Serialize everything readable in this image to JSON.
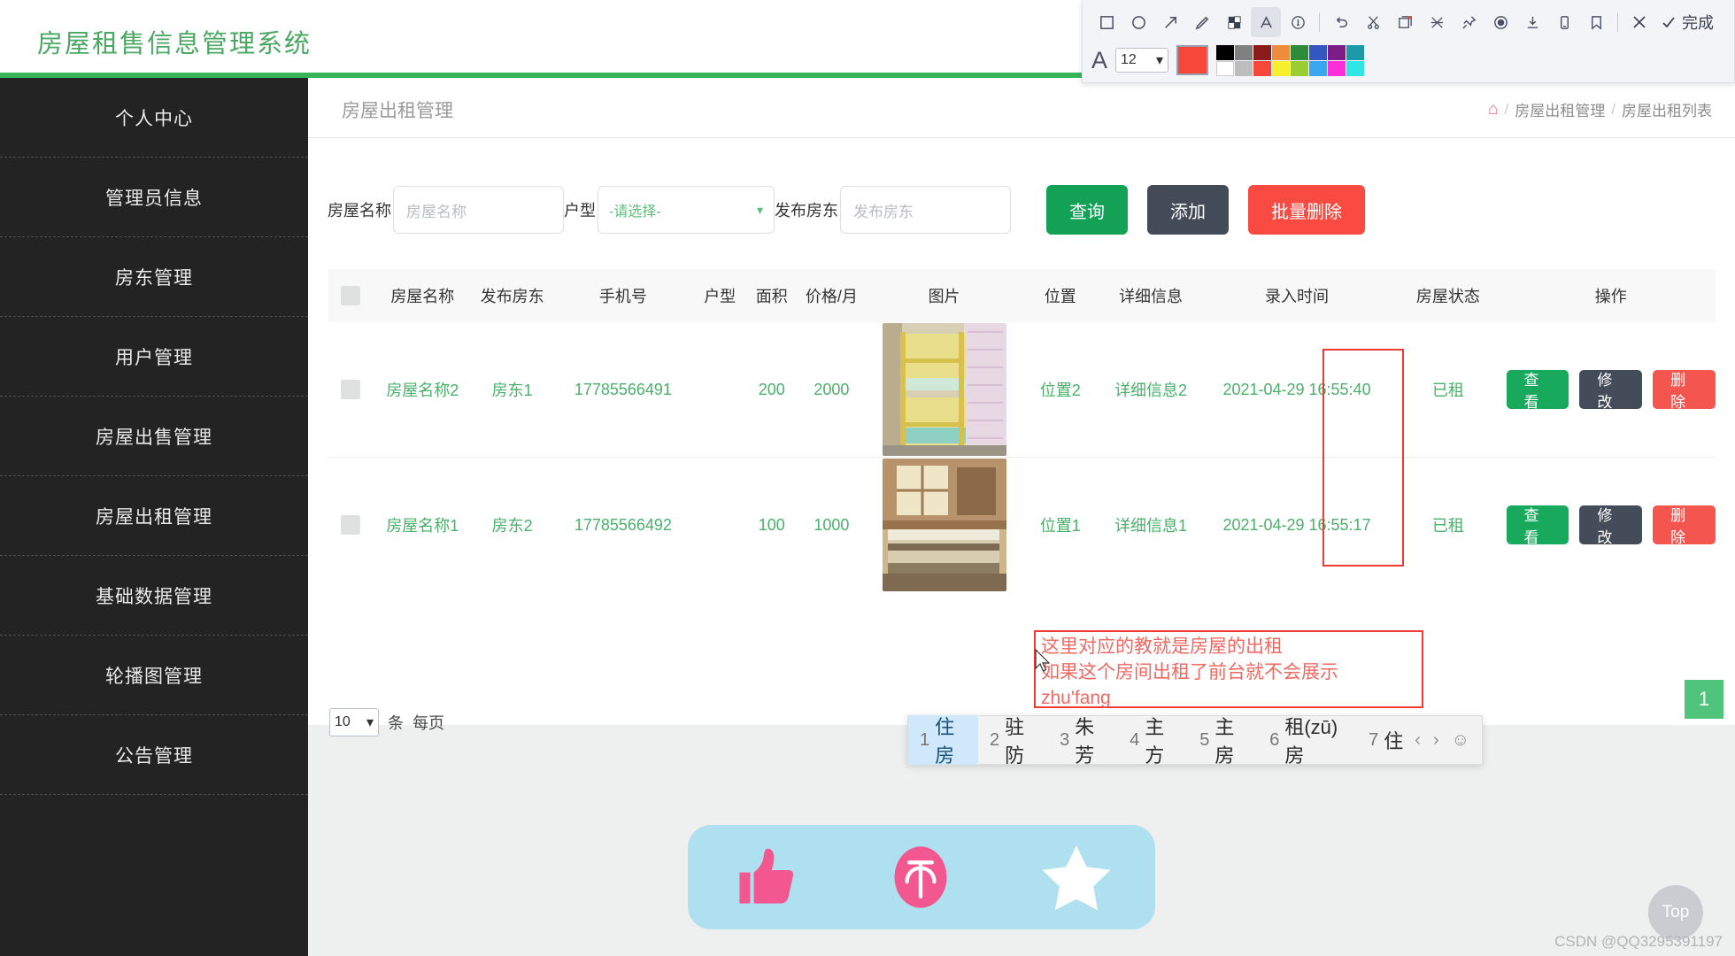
{
  "header": {
    "title": "房屋租售信息管理系统",
    "accent_color": "#35b558",
    "avatar_icon": "user-avatar"
  },
  "annotation_toolbar": {
    "tools": [
      {
        "name": "rect-tool",
        "glyph": "▢"
      },
      {
        "name": "ellipse-tool",
        "glyph": "◯"
      },
      {
        "name": "arrow-tool",
        "glyph": "↗"
      },
      {
        "name": "pencil-tool",
        "glyph": "✎"
      },
      {
        "name": "mosaic-tool",
        "glyph": "▩"
      },
      {
        "name": "text-tool",
        "glyph": "A"
      },
      {
        "name": "numbering-tool",
        "glyph": "①"
      },
      {
        "name": "undo-tool",
        "glyph": "↺"
      },
      {
        "name": "cut-tool",
        "glyph": "✄"
      },
      {
        "name": "ocr-tool",
        "glyph": "🗐"
      },
      {
        "name": "translate-tool",
        "glyph": "⤫"
      },
      {
        "name": "pin-tool",
        "glyph": "📌"
      },
      {
        "name": "record-tool",
        "glyph": "◉"
      },
      {
        "name": "download-tool",
        "glyph": "⤓"
      },
      {
        "name": "save-phone-tool",
        "glyph": "▤"
      },
      {
        "name": "bookmark-tool",
        "glyph": "⛉"
      },
      {
        "name": "cancel-tool",
        "glyph": "✕"
      }
    ],
    "done_label": "完成",
    "done_check": "✓",
    "font_icon": "A",
    "font_size": "12",
    "current_color": "#f5483b",
    "palette_row1": [
      "#000000",
      "#808080",
      "#8b1a1a",
      "#ef8b3c",
      "#2e8b3a",
      "#3456c0",
      "#7d1d87",
      "#1c9aa8"
    ],
    "palette_row2": [
      "#ffffff",
      "#bdbdbd",
      "#f5483b",
      "#f7ef2b",
      "#9acd32",
      "#3aa8f0",
      "#ff2fd8",
      "#2fe6e6"
    ]
  },
  "sidebar": {
    "items": [
      {
        "label": "个人中心",
        "name": "sidebar-item-personal-center"
      },
      {
        "label": "管理员信息",
        "name": "sidebar-item-admin-info"
      },
      {
        "label": "房东管理",
        "name": "sidebar-item-landlord-manage"
      },
      {
        "label": "用户管理",
        "name": "sidebar-item-user-manage"
      },
      {
        "label": "房屋出售管理",
        "name": "sidebar-item-house-sale-manage"
      },
      {
        "label": "房屋出租管理",
        "name": "sidebar-item-house-rent-manage"
      },
      {
        "label": "基础数据管理",
        "name": "sidebar-item-basic-data-manage"
      },
      {
        "label": "轮播图管理",
        "name": "sidebar-item-carousel-manage"
      },
      {
        "label": "公告管理",
        "name": "sidebar-item-notice-manage"
      }
    ]
  },
  "page": {
    "title": "房屋出租管理",
    "breadcrumb": {
      "home_icon": "home-icon",
      "sep": "/",
      "level1": "房屋出租管理",
      "level2": "房屋出租列表"
    }
  },
  "search": {
    "house_name_label": "房屋名称",
    "house_name_placeholder": "房屋名称",
    "house_name_value": "",
    "type_label": "户型",
    "type_selected": "-请选择-",
    "landlord_label": "发布房东",
    "landlord_placeholder": "发布房东",
    "landlord_value": "",
    "btn_query": "查询",
    "btn_add": "添加",
    "btn_batch_delete": "批量删除"
  },
  "table": {
    "headers": {
      "select": "",
      "house_name": "房屋名称",
      "landlord": "发布房东",
      "phone": "手机号",
      "type": "户型",
      "area": "面积",
      "price": "价格/月",
      "image": "图片",
      "location": "位置",
      "detail": "详细信息",
      "created": "录入时间",
      "status": "房屋状态",
      "ops": "操作"
    },
    "op_labels": {
      "view": "查看",
      "edit": "修改",
      "delete": "删除"
    },
    "rows": [
      {
        "house_name": "房屋名称2",
        "landlord": "房东1",
        "phone": "17785566491",
        "type": "",
        "area": "200",
        "price": "2000",
        "image_alt": "bunk-bed-photo",
        "location": "位置2",
        "detail": "详细信息2",
        "created": "2021-04-29 16:55:40",
        "status": "已租"
      },
      {
        "house_name": "房屋名称1",
        "landlord": "房东2",
        "phone": "17785566492",
        "type": "",
        "area": "100",
        "price": "1000",
        "image_alt": "bedroom-window-photo",
        "location": "位置1",
        "detail": "详细信息1",
        "created": "2021-04-29 16:55:17",
        "status": "已租"
      }
    ]
  },
  "pager": {
    "page_size": "10",
    "unit": "条",
    "per_page": "每页"
  },
  "annotations": {
    "color": "#ef3b33",
    "note_line1": "这里对应的教就是房屋的出租",
    "note_line2": "如果这个房间出租了前台就不会展示",
    "note_line3": "zhu'fang"
  },
  "ime": {
    "candidates": [
      {
        "num": "1",
        "text": "住房",
        "selected": true
      },
      {
        "num": "2",
        "text": "驻防",
        "selected": false
      },
      {
        "num": "3",
        "text": "朱芳",
        "selected": false
      },
      {
        "num": "4",
        "text": "主方",
        "selected": false
      },
      {
        "num": "5",
        "text": "主房",
        "selected": false
      },
      {
        "num": "6",
        "text": "租(zū)房",
        "selected": false
      },
      {
        "num": "7",
        "text": "住",
        "selected": false
      }
    ],
    "prev": "‹",
    "next": "›",
    "emoji": "☺"
  },
  "float": {
    "badge_one": "1",
    "top_label": "Top"
  },
  "social": {
    "like_icon": "thumbs-up-icon",
    "coin_icon": "coin-icon",
    "star_icon": "star-icon"
  },
  "watermark": "CSDN @QQ3295391197"
}
